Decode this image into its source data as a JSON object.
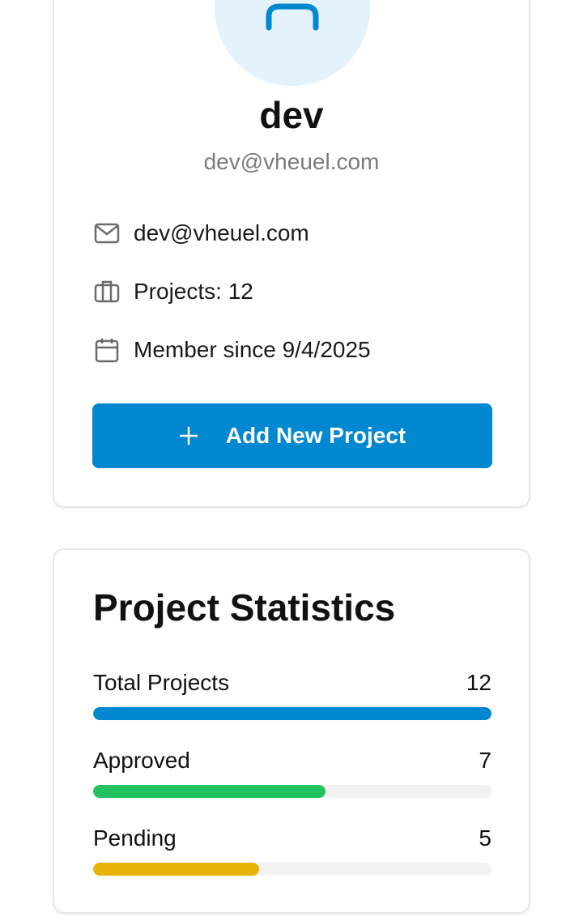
{
  "profile": {
    "name": "dev",
    "email": "dev@vheuel.com",
    "details": {
      "email": "dev@vheuel.com",
      "projects": "Projects: 12",
      "member_since": "Member since 9/4/2025"
    },
    "add_button_label": "Add New Project",
    "icons": [
      "user-icon",
      "mail-icon",
      "briefcase-icon",
      "calendar-icon",
      "plus-icon"
    ]
  },
  "stats": {
    "title": "Project Statistics",
    "items": [
      {
        "label": "Total Projects",
        "value": "12",
        "fraction": 1.0,
        "color": "#0288d1"
      },
      {
        "label": "Approved",
        "value": "7",
        "fraction": 0.5833,
        "color": "#22c35e"
      },
      {
        "label": "Pending",
        "value": "5",
        "fraction": 0.4167,
        "color": "#eab308"
      }
    ]
  },
  "colors": {
    "accent": "#0288d1",
    "avatar_bg": "#e3f2fb",
    "muted_text": "#7b7b7b"
  }
}
